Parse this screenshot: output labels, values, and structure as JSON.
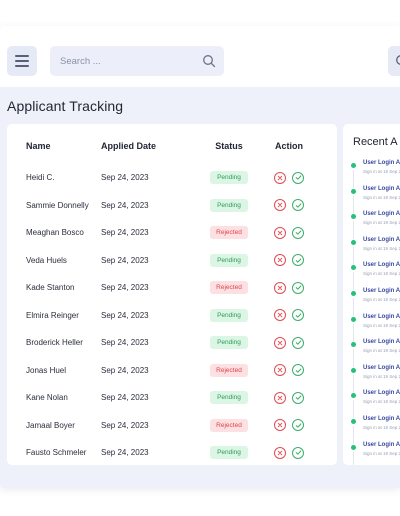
{
  "header": {
    "search_placeholder": "Search ..."
  },
  "page": {
    "title": "Applicant Tracking"
  },
  "table": {
    "columns": [
      "Name",
      "Applied Date",
      "Status",
      "Action"
    ],
    "rows": [
      {
        "name": "Heidi C.",
        "date": "Sep 24, 2023",
        "status": "Pending"
      },
      {
        "name": "Sammie Donnelly",
        "date": "Sep 24, 2023",
        "status": "Pending"
      },
      {
        "name": "Meaghan Bosco",
        "date": "Sep 24, 2023",
        "status": "Rejected"
      },
      {
        "name": "Veda Huels",
        "date": "Sep 24, 2023",
        "status": "Pending"
      },
      {
        "name": "Kade Stanton",
        "date": "Sep 24, 2023",
        "status": "Rejected"
      },
      {
        "name": "Elmira Reinger",
        "date": "Sep 24, 2023",
        "status": "Pending"
      },
      {
        "name": "Broderick Heller",
        "date": "Sep 24, 2023",
        "status": "Pending"
      },
      {
        "name": "Jonas Huel",
        "date": "Sep 24, 2023",
        "status": "Rejected"
      },
      {
        "name": "Kane Nolan",
        "date": "Sep 24, 2023",
        "status": "Pending"
      },
      {
        "name": "Jamaal Boyer",
        "date": "Sep 24, 2023",
        "status": "Rejected"
      },
      {
        "name": "Fausto Schmeler",
        "date": "Sep 24, 2023",
        "status": "Pending"
      }
    ]
  },
  "activity": {
    "title": "Recent A",
    "items": [
      {
        "title": "User Login Ac",
        "sub": "Sign in at 19 Sep 2"
      },
      {
        "title": "User Login Ac",
        "sub": "Sign in at 19 Sep 2"
      },
      {
        "title": "User Login Ac",
        "sub": "Sign in at 19 Sep 2"
      },
      {
        "title": "User Login Ac",
        "sub": "Sign in at 19 Sep 2"
      },
      {
        "title": "User Login Ac",
        "sub": "Sign in at 19 Sep 2"
      },
      {
        "title": "User Login Ac",
        "sub": "Sign in at 19 Sep 2"
      },
      {
        "title": "User Login Ac",
        "sub": "Sign in at 19 Sep 2"
      },
      {
        "title": "User Login Ac",
        "sub": "Sign in at 19 Sep 2"
      },
      {
        "title": "User Login Ac",
        "sub": "Sign in at 19 Sep 2"
      },
      {
        "title": "User Login Ac",
        "sub": "Sign in at 19 Sep 2"
      },
      {
        "title": "User Login Ac",
        "sub": "Sign in at 19 Sep 2"
      },
      {
        "title": "User Login Ac",
        "sub": "Sign in at 19 Sep 2"
      }
    ]
  },
  "icons": {
    "menu": "hamburger-menu-icon",
    "search": "search-icon",
    "reject": "x-circle-icon",
    "approve": "check-circle-icon"
  },
  "colors": {
    "pending_bg": "#dcf6e6",
    "pending_text": "#2f9a5a",
    "rejected_bg": "#fde0e1",
    "rejected_text": "#e0454c",
    "reject_icon": "#e14b52",
    "approve_icon": "#3cae6a",
    "activity_dot": "#26c07a"
  }
}
